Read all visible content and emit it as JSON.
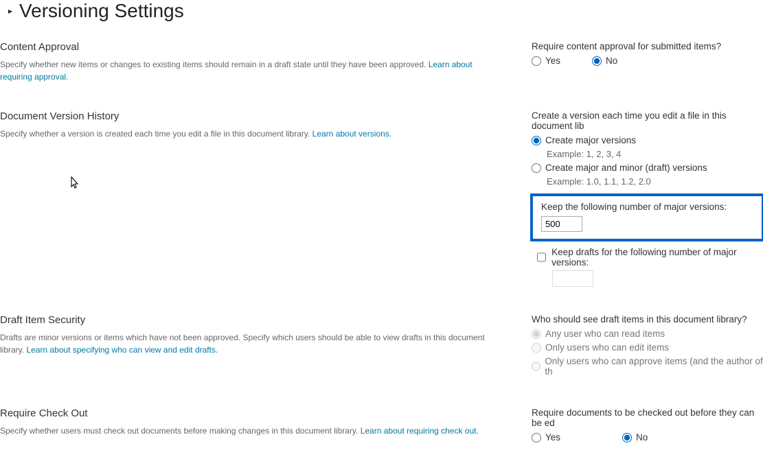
{
  "page": {
    "caret": "▸",
    "title": "Versioning Settings"
  },
  "contentApproval": {
    "title": "Content Approval",
    "desc": "Specify whether new items or changes to existing items should remain in a draft state until they have been approved.  ",
    "link": "Learn about requiring approval.",
    "prompt": "Require content approval for submitted items?",
    "yes": "Yes",
    "no": "No"
  },
  "versionHistory": {
    "title": "Document Version History",
    "desc": "Specify whether a version is created each time you edit a file in this document library.  ",
    "link": "Learn about versions.",
    "prompt": "Create a version each time you edit a file in this document lib",
    "optMajor": "Create major versions",
    "exMajor": "Example: 1, 2, 3, 4",
    "optMinor": "Create major and minor (draft) versions",
    "exMinor": "Example: 1.0, 1.1, 1.2, 2.0",
    "keepMajorLabel": "Keep the following number of major versions:",
    "keepMajorValue": "500",
    "keepDraftsLabel": "Keep drafts for the following number of major versions:"
  },
  "draftSecurity": {
    "title": "Draft Item Security",
    "desc": "Drafts are minor versions or items which have not been approved. Specify which users should be able to view drafts in this document library.  ",
    "link": "Learn about specifying who can view and edit drafts.",
    "prompt": "Who should see draft items in this document library?",
    "opt1": "Any user who can read items",
    "opt2": "Only users who can edit items",
    "opt3": "Only users who can approve items (and the author of th"
  },
  "checkout": {
    "title": "Require Check Out",
    "desc": "Specify whether users must check out documents before making changes in this document library.  ",
    "link": "Learn about requiring check out.",
    "prompt": "Require documents to be checked out before they can be ed",
    "yes": "Yes",
    "no": "No"
  }
}
